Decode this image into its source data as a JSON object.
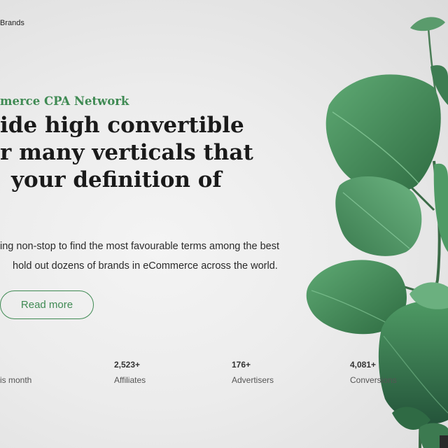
{
  "nav": {
    "brand_fragment": "Brands"
  },
  "hero": {
    "eyebrow": "merce CPA Network",
    "headline_lines": [
      "ide high convertible",
      "r many verticals that",
      "your definition of"
    ],
    "description_lines": [
      "ing non-stop to find the most favourable terms among the best",
      "hold out dozens of brands in eCommerce across the world."
    ],
    "cta_label": "Read more",
    "accent_color": "#3f8a53"
  },
  "stats": [
    {
      "value": "",
      "label": "is month"
    },
    {
      "value": "2,523+",
      "label": "Affiliates"
    },
    {
      "value": "176+",
      "label": "Advertisers"
    },
    {
      "value": "4,081+",
      "label": "Conversions"
    }
  ]
}
